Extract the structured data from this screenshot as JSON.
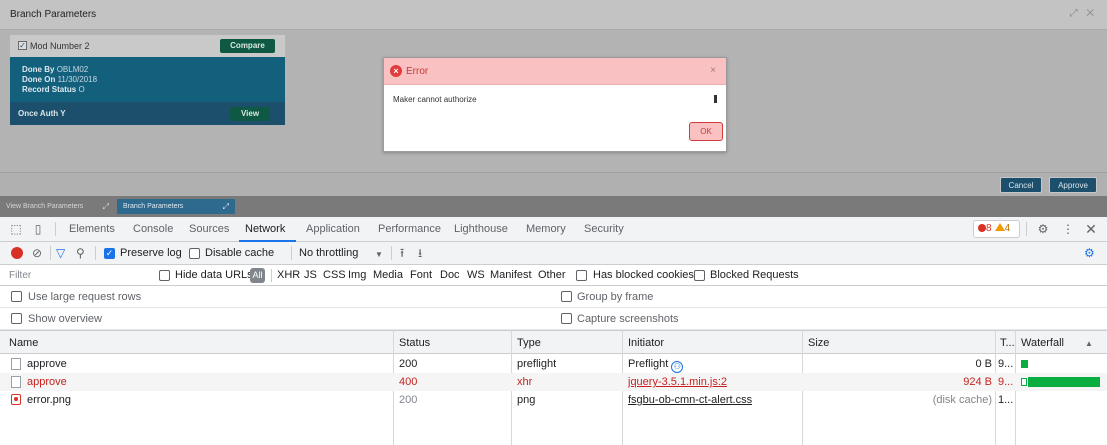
{
  "app": {
    "window_title": "Branch Parameters",
    "window_controls": "⤢ ✕",
    "card": {
      "mod_label": "Mod Number 2",
      "compare_label": "Compare",
      "done_by_label": "Done By",
      "done_by_value": "OBLM02",
      "done_on_label": "Done On",
      "done_on_value": "11/30/2018",
      "record_status_label": "Record Status",
      "record_status_value": "O",
      "once_auth_label": "Once Auth",
      "once_auth_value": "Y",
      "view_label": "View"
    },
    "footer": {
      "cancel_label": "Cancel",
      "approve_label": "Approve"
    },
    "taskbar": [
      {
        "label": "View Branch Parameters"
      },
      {
        "label": "Branch Parameters"
      }
    ]
  },
  "dialog": {
    "title": "Error",
    "message": "Maker cannot authorize",
    "ok_label": "OK"
  },
  "devtools": {
    "tabs": [
      "Elements",
      "Console",
      "Sources",
      "Network",
      "Application",
      "Performance",
      "Lighthouse",
      "Memory",
      "Security"
    ],
    "active_tab": "Network",
    "error_count": "8",
    "warning_count": "4",
    "toolbar": {
      "preserve_log_label": "Preserve log",
      "preserve_log_checked": true,
      "disable_cache_label": "Disable cache",
      "throttling_value": "No throttling"
    },
    "filter": {
      "placeholder": "Filter",
      "hide_data_urls_label": "Hide data URLs",
      "types": [
        "All",
        "XHR",
        "JS",
        "CSS",
        "Img",
        "Media",
        "Font",
        "Doc",
        "WS",
        "Manifest",
        "Other"
      ],
      "has_blocked_cookies_label": "Has blocked cookies",
      "blocked_requests_label": "Blocked Requests"
    },
    "options": {
      "large_rows_label": "Use large request rows",
      "group_by_frame_label": "Group by frame",
      "show_overview_label": "Show overview",
      "capture_screenshots_label": "Capture screenshots"
    },
    "table": {
      "columns": [
        "Name",
        "Status",
        "Type",
        "Initiator",
        "Size",
        "T...",
        "Waterfall"
      ],
      "rows": [
        {
          "name": "approve",
          "status": "200",
          "type": "preflight",
          "initiator": "Preflight",
          "size": "0 B",
          "time": "9...",
          "state": "normal"
        },
        {
          "name": "approve",
          "status": "400",
          "type": "xhr",
          "initiator": "jquery-3.5.1.min.js:2",
          "size": "924 B",
          "time": "9...",
          "state": "error"
        },
        {
          "name": "error.png",
          "status": "200",
          "type": "png",
          "initiator": "fsgbu-ob-cmn-ct-alert.css",
          "size": "(disk cache)",
          "time": "1...",
          "state": "cached"
        }
      ]
    }
  }
}
